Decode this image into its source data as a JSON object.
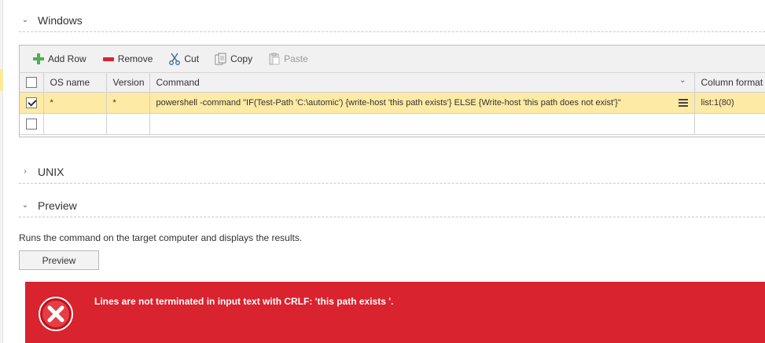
{
  "sections": {
    "windows": {
      "title": "Windows",
      "expanded": true
    },
    "unix": {
      "title": "UNIX",
      "expanded": false
    },
    "preview": {
      "title": "Preview",
      "expanded": true
    }
  },
  "toolbar": {
    "add_row": "Add Row",
    "remove": "Remove",
    "cut": "Cut",
    "copy": "Copy",
    "paste": "Paste"
  },
  "table": {
    "columns": [
      "OS name",
      "Version",
      "Command",
      "Column format"
    ],
    "rows": [
      {
        "checked": true,
        "os_name": "*",
        "version": "*",
        "command": "powershell -command \"IF(Test-Path 'C:\\automic') {write-host 'this path exists'} ELSE {Write-host 'this path does not exist'}\"",
        "column_format": "list:1(80)"
      },
      {
        "checked": false,
        "os_name": "",
        "version": "",
        "command": "",
        "column_format": ""
      }
    ]
  },
  "preview": {
    "description": "Runs the command on the target computer and displays the results.",
    "button_label": "Preview"
  },
  "error": {
    "message": "Lines are not terminated in input text with CRLF: 'this path exists '.",
    "color": "#d9232e"
  }
}
